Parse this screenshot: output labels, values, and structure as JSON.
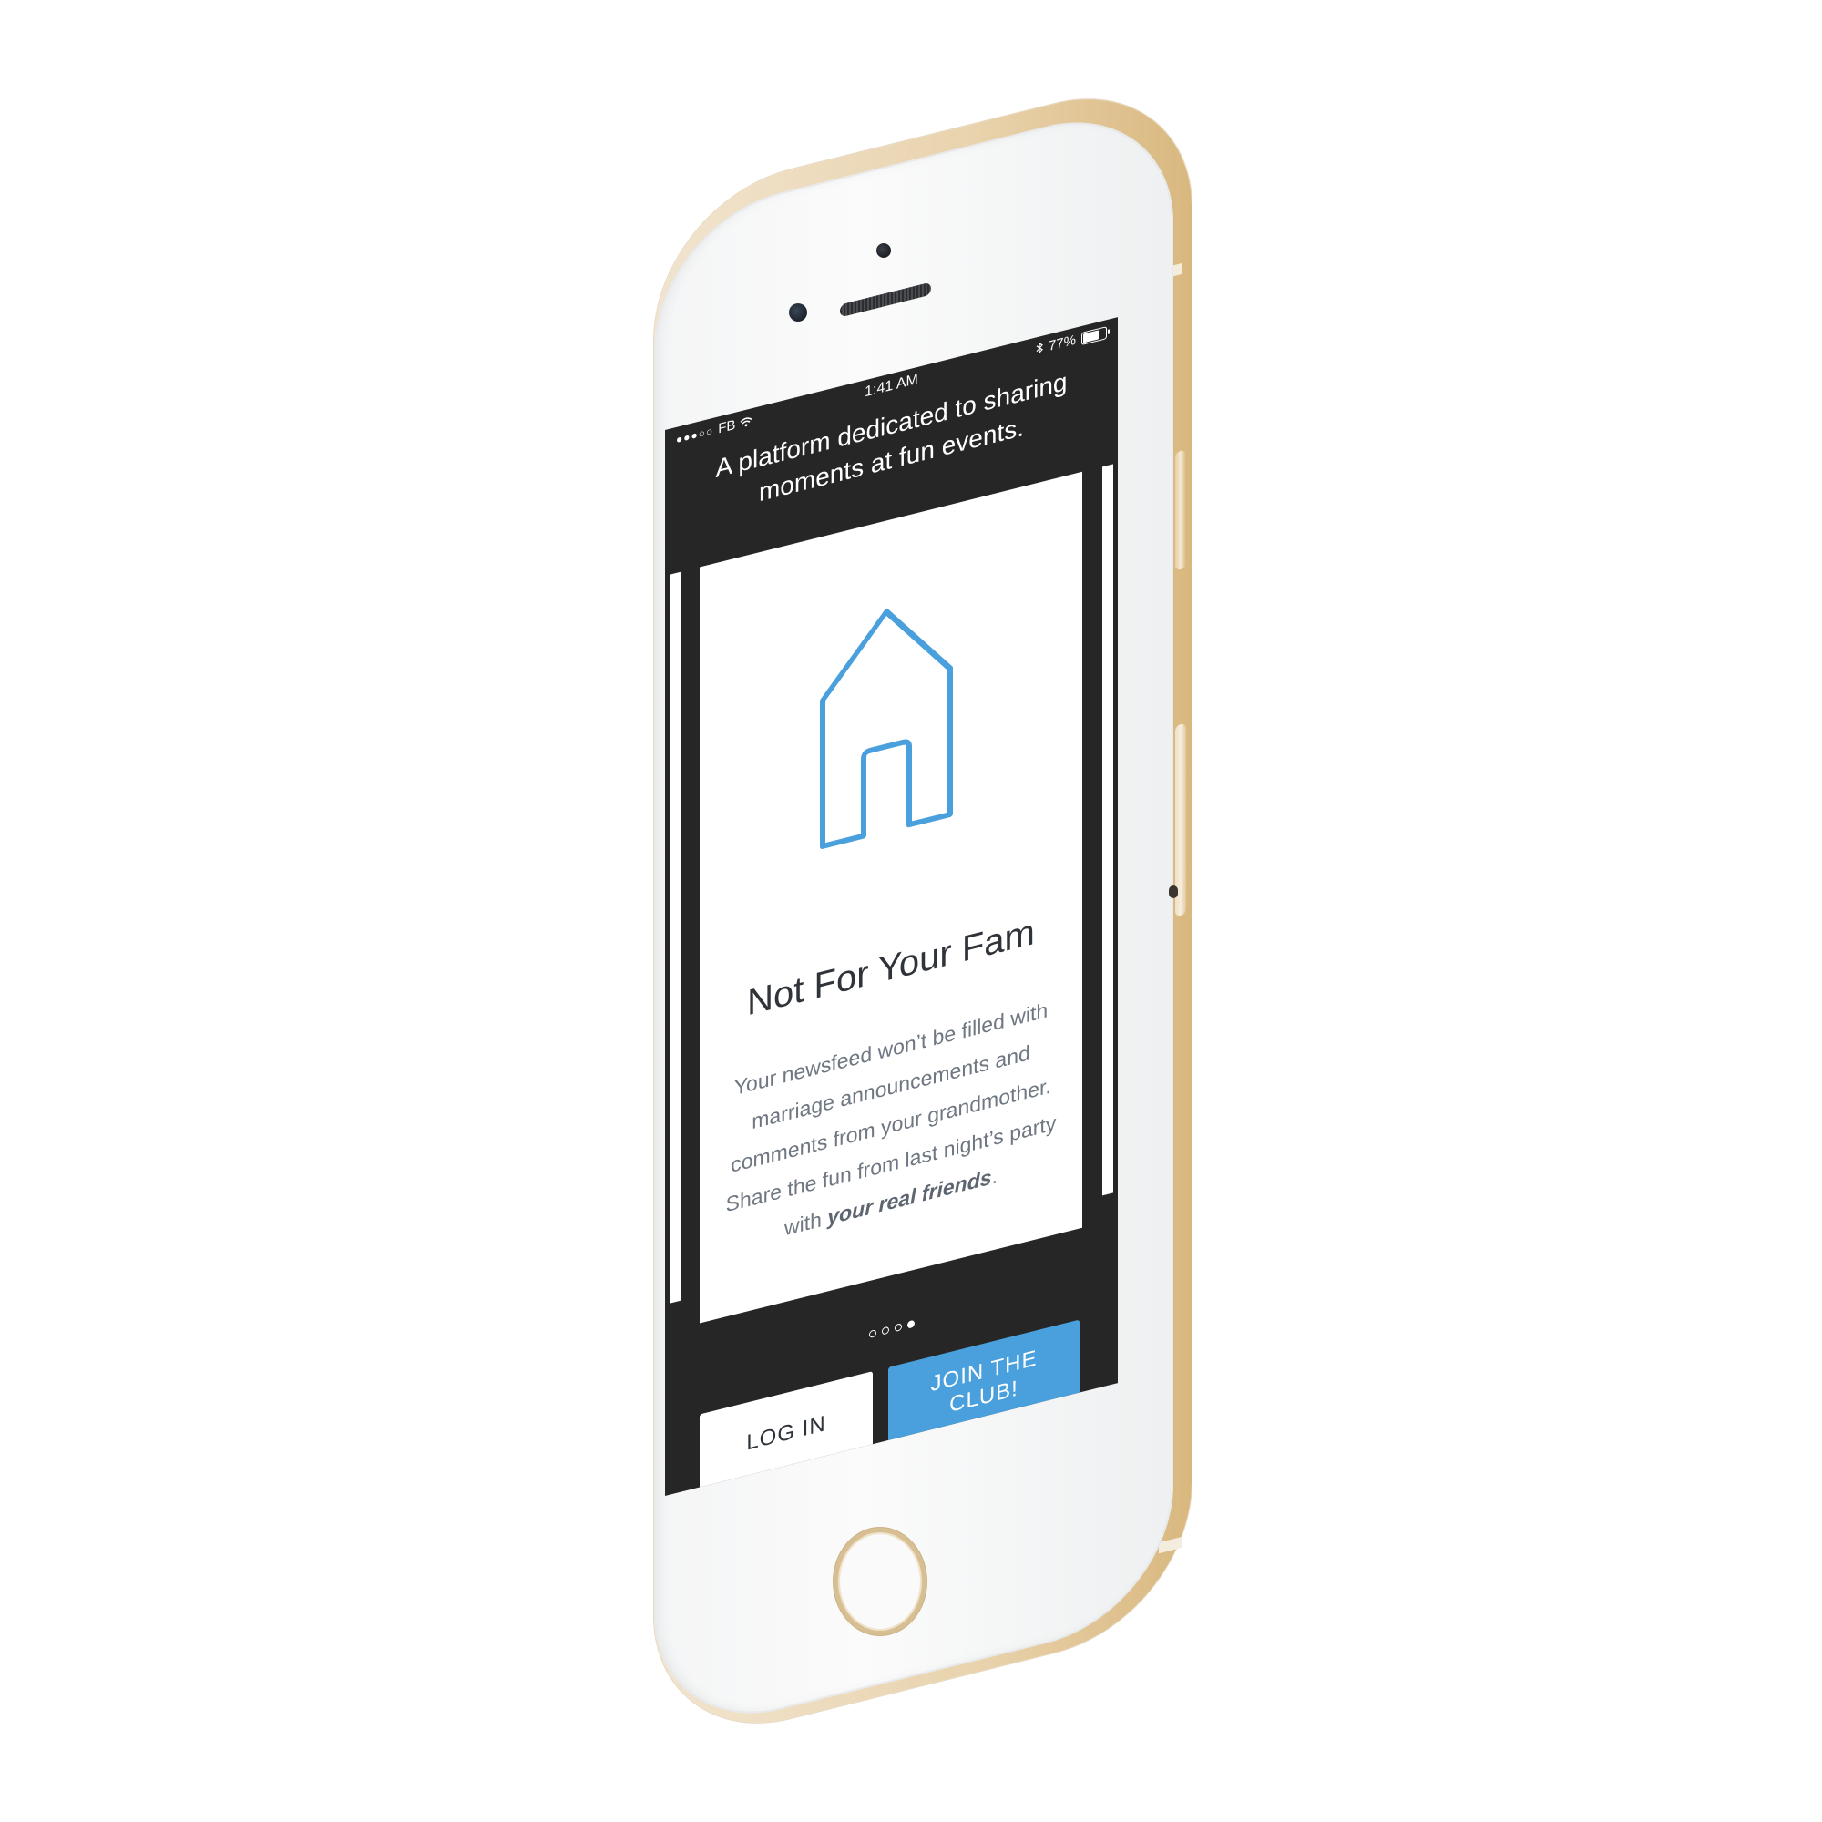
{
  "status_bar": {
    "carrier": "FB",
    "signal": "●●●○○",
    "time": "1:41 AM",
    "battery_percent": "77%",
    "battery_level": 0.77
  },
  "header": {
    "tagline": "A platform dedicated to sharing moments at fun events."
  },
  "card": {
    "icon": "house-icon",
    "title": "Not For Your Fam",
    "body_lead": "Your newsfeed won’t be filled with marriage announcements and comments from your grandmother. Share the fun from last night’s party with ",
    "body_emphasis": "your real friends",
    "body_tail": "."
  },
  "pager": {
    "count": 4,
    "active_index": 3
  },
  "actions": {
    "login_label": "LOG IN",
    "join_label": "JOIN THE CLUB!"
  },
  "colors": {
    "accent": "#4aa0dc",
    "screen_bg": "#262626",
    "text_dark": "#2f343a",
    "text_muted": "#6f7782",
    "phone_gold": "#e9d3ad"
  }
}
